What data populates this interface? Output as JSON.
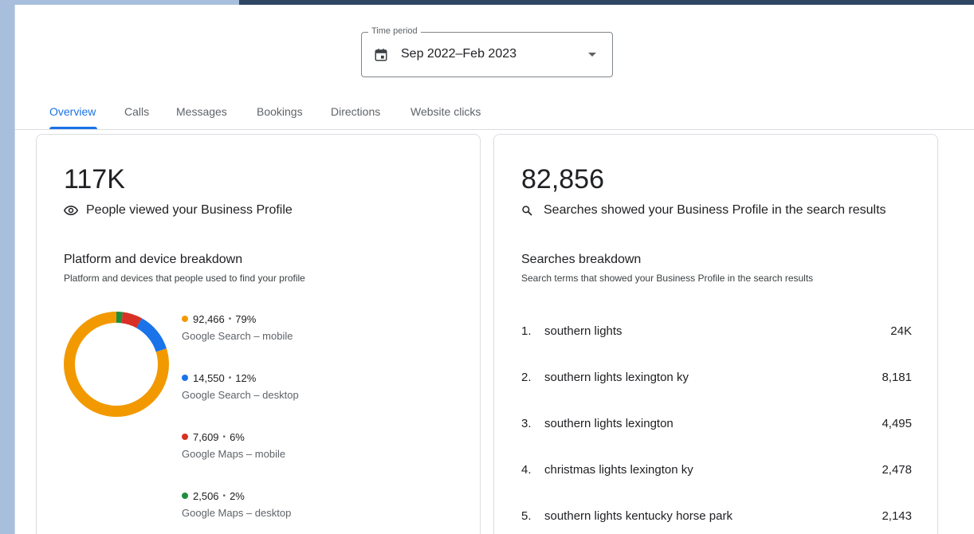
{
  "colors": {
    "accent": "#1a73e8",
    "google_search_mobile": "#f29900",
    "google_search_desktop": "#1a73e8",
    "google_maps_mobile": "#d93025",
    "google_maps_desktop": "#1e8e3e"
  },
  "time_period": {
    "label": "Time period",
    "value": "Sep 2022–Feb 2023",
    "icon": "calendar-icon"
  },
  "tabs": [
    {
      "label": "Overview",
      "active": true
    },
    {
      "label": "Calls",
      "active": false
    },
    {
      "label": "Messages",
      "active": false
    },
    {
      "label": "Bookings",
      "active": false
    },
    {
      "label": "Directions",
      "active": false
    },
    {
      "label": "Website clicks",
      "active": false
    }
  ],
  "profile_views": {
    "total": "117K",
    "description": "People viewed your Business Profile",
    "icon": "eye-icon",
    "breakdown_title": "Platform and device breakdown",
    "breakdown_subtitle": "Platform and devices that people used to find your profile",
    "items": [
      {
        "value": "92,466",
        "percent": "79%",
        "label": "Google Search – mobile",
        "share": 79
      },
      {
        "value": "14,550",
        "percent": "12%",
        "label": "Google Search – desktop",
        "share": 12
      },
      {
        "value": "7,609",
        "percent": "6%",
        "label": "Google Maps – mobile",
        "share": 6
      },
      {
        "value": "2,506",
        "percent": "2%",
        "label": "Google Maps – desktop",
        "share": 2
      }
    ]
  },
  "searches": {
    "total": "82,856",
    "description": "Searches showed your Business Profile in the search results",
    "icon": "search-icon",
    "breakdown_title": "Searches breakdown",
    "breakdown_subtitle": "Search terms that showed your Business Profile in the search results",
    "items": [
      {
        "rank": "1.",
        "term": "southern lights",
        "value": "24K"
      },
      {
        "rank": "2.",
        "term": "southern lights lexington ky",
        "value": "8,181"
      },
      {
        "rank": "3.",
        "term": "southern lights lexington",
        "value": "4,495"
      },
      {
        "rank": "4.",
        "term": "christmas lights lexington ky",
        "value": "2,478"
      },
      {
        "rank": "5.",
        "term": "southern lights kentucky horse park",
        "value": "2,143"
      }
    ]
  }
}
